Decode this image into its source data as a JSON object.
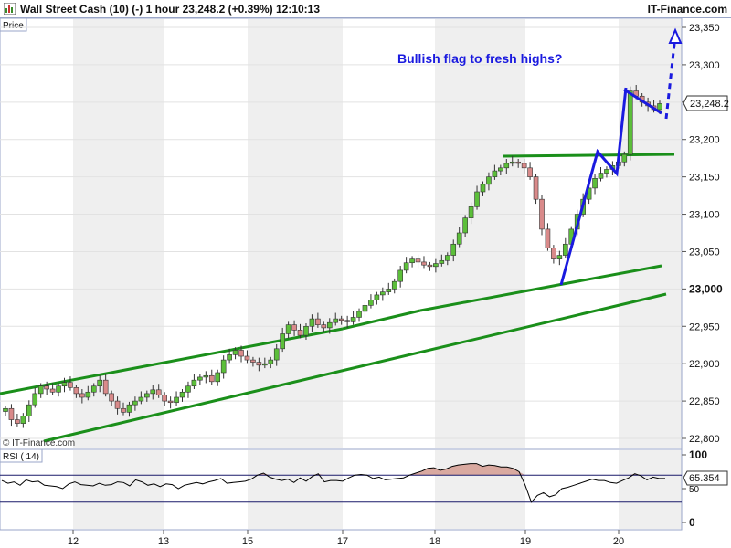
{
  "header": {
    "title": "Wall Street Cash (10) (-)   1 hour   23,248.2 (+0.39%)   12:10:13",
    "brand": "IT-Finance.com"
  },
  "price_panel": {
    "label": "Price",
    "annotation": "Bullish flag to fresh highs?",
    "copyright": "© IT-Finance.com",
    "last_price_label": "23,248.2"
  },
  "rsi_panel": {
    "label": "RSI ( 14)",
    "value_label": "65.354"
  },
  "colors": {
    "up_candle": "#5cbf3a",
    "down_candle": "#d98a8a",
    "trendline": "#1a8f1a",
    "annotation": "#1a1adf",
    "band": "#efefef",
    "rsi_fill": "#d9a9a0",
    "rsi_line": "#000000"
  },
  "chart_data": [
    {
      "type": "candlestick",
      "title": "",
      "x": [
        "12",
        "13",
        "15",
        "17",
        "18",
        "19",
        "20"
      ],
      "yticks": [
        "22,800",
        "22,850",
        "22,900",
        "22,950",
        "23,000",
        "23,050",
        "23,100",
        "23,150",
        "23,200",
        "23,250",
        "23,300",
        "23,350"
      ],
      "ylim": [
        22790,
        23360
      ],
      "last_value": 23248.2,
      "close_series": [
        22840,
        22825,
        22820,
        22830,
        22845,
        22860,
        22870,
        22866,
        22862,
        22870,
        22875,
        22868,
        22860,
        22855,
        22862,
        22870,
        22878,
        22860,
        22850,
        22840,
        22835,
        22845,
        22850,
        22855,
        22860,
        22865,
        22858,
        22850,
        22848,
        22855,
        22862,
        22870,
        22878,
        22882,
        22884,
        22876,
        22888,
        22905,
        22912,
        22918,
        22910,
        22905,
        22902,
        22898,
        22900,
        22905,
        22920,
        22940,
        22952,
        22945,
        22938,
        22950,
        22960,
        22952,
        22948,
        22955,
        22960,
        22958,
        22956,
        22962,
        22970,
        22978,
        22985,
        22992,
        22996,
        23000,
        23010,
        23025,
        23035,
        23040,
        23036,
        23032,
        23030,
        23034,
        23038,
        23045,
        23060,
        23075,
        23095,
        23110,
        23130,
        23140,
        23150,
        23158,
        23162,
        23168,
        23170,
        23168,
        23162,
        23150,
        23120,
        23080,
        23055,
        23040,
        23045,
        23060,
        23080,
        23100,
        23120,
        23135,
        23148,
        23155,
        23160,
        23165,
        23170,
        23180,
        23265,
        23258,
        23250,
        23245,
        23240,
        23248
      ],
      "annotations": [
        "Bullish flag to fresh highs?"
      ]
    },
    {
      "type": "line",
      "title": "RSI ( 14)",
      "yticks": [
        "0",
        "50",
        "100"
      ],
      "ylim": [
        0,
        100
      ],
      "reference_levels": [
        70,
        30
      ],
      "last_value": 65.354,
      "values": [
        62,
        58,
        60,
        55,
        63,
        60,
        61,
        55,
        54,
        53,
        50,
        57,
        60,
        56,
        55,
        54,
        58,
        55,
        56,
        60,
        59,
        54,
        63,
        60,
        55,
        57,
        53,
        57,
        56,
        50,
        55,
        57,
        59,
        57,
        60,
        62,
        65,
        58,
        59,
        60,
        61,
        64,
        70,
        73,
        67,
        64,
        62,
        64,
        59,
        66,
        61,
        68,
        72,
        60,
        62,
        62,
        61,
        66,
        70,
        71,
        70,
        65,
        67,
        63,
        64,
        65,
        66,
        70,
        73,
        76,
        80,
        81,
        77,
        79,
        83,
        85,
        86,
        87,
        87,
        83,
        85,
        84,
        82,
        82,
        80,
        75,
        55,
        30,
        40,
        44,
        38,
        41,
        50,
        52,
        55,
        58,
        61,
        64,
        62,
        62,
        59,
        58,
        62,
        66,
        72,
        69,
        63,
        67,
        65,
        65
      ]
    }
  ]
}
